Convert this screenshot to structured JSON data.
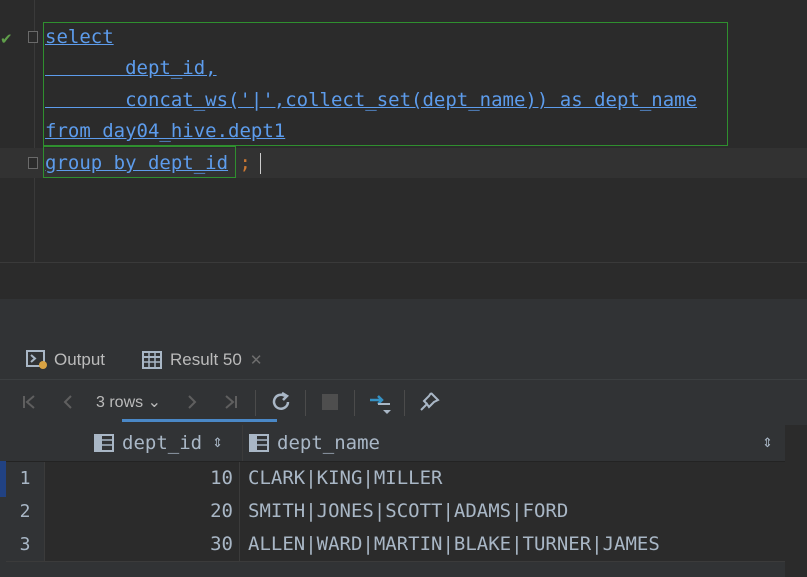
{
  "editor": {
    "lines": [
      {
        "text": "select"
      },
      {
        "text": "       dept_id,"
      },
      {
        "text": "       concat_ws('|',collect_set(dept_name)) as dept_name"
      },
      {
        "text": "from day04_hive.dept1"
      },
      {
        "text": "group by dept_id"
      }
    ],
    "terminator": " ;"
  },
  "tabs": {
    "output_label": "Output",
    "result_label": "Result 50",
    "result_close": "✕"
  },
  "toolbar": {
    "rows_label": "3 rows ⌄"
  },
  "grid": {
    "columns": [
      "dept_id",
      "dept_name"
    ],
    "rows": [
      {
        "num": "1",
        "dept_id": "10",
        "dept_name": "CLARK|KING|MILLER"
      },
      {
        "num": "2",
        "dept_id": "20",
        "dept_name": "SMITH|JONES|SCOTT|ADAMS|FORD"
      },
      {
        "num": "3",
        "dept_id": "30",
        "dept_name": "ALLEN|WARD|MARTIN|BLAKE|TURNER|JAMES"
      }
    ]
  },
  "colors": {
    "keyword": "#5d9cec",
    "selection_border": "#2f8f2f",
    "tab_accent": "#4a88c7",
    "toolbar_accent": "#3592c4"
  }
}
